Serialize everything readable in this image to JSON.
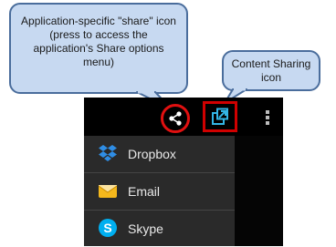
{
  "callouts": {
    "share": "Application-specific \"share\" icon (press to access the application's Share options menu)",
    "content_sharing": "Content Sharing icon"
  },
  "menu": {
    "items": [
      {
        "label": "Dropbox",
        "icon": "dropbox-icon"
      },
      {
        "label": "Email",
        "icon": "email-icon"
      },
      {
        "label": "Skype",
        "icon": "skype-icon"
      }
    ]
  },
  "action_bar": {
    "icons": [
      "share-icon",
      "content-sharing-icon",
      "overflow-menu-icon"
    ]
  },
  "colors": {
    "callout_fill": "#c7d9f1",
    "callout_border": "#4a6d9c",
    "highlight_red": "#d00000",
    "action_bar": "#000000",
    "menu_bg": "#2a2a2a",
    "accent_cyan": "#33b5e5"
  }
}
